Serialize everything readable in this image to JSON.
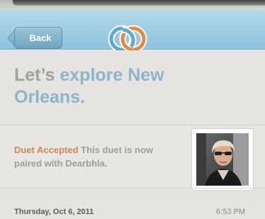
{
  "navbar": {
    "back_label": "Back",
    "logo_icon": "interlocking-rings-logo-icon",
    "colors": {
      "bar": "#9fcde3",
      "ring_blue": "#6fb1d6",
      "ring_orange": "#e6873c"
    }
  },
  "headline": {
    "prefix": "Let’s ",
    "accent": "explore New Orleans."
  },
  "status": {
    "label": "Duet Accepted",
    "message": "This duet is now paired with Dearbhla.",
    "label_color": "#d2884d",
    "avatar_icon": "user-photo"
  },
  "footer": {
    "date": "Thursday, Oct 6, 2011",
    "time": "6:53 PM"
  }
}
